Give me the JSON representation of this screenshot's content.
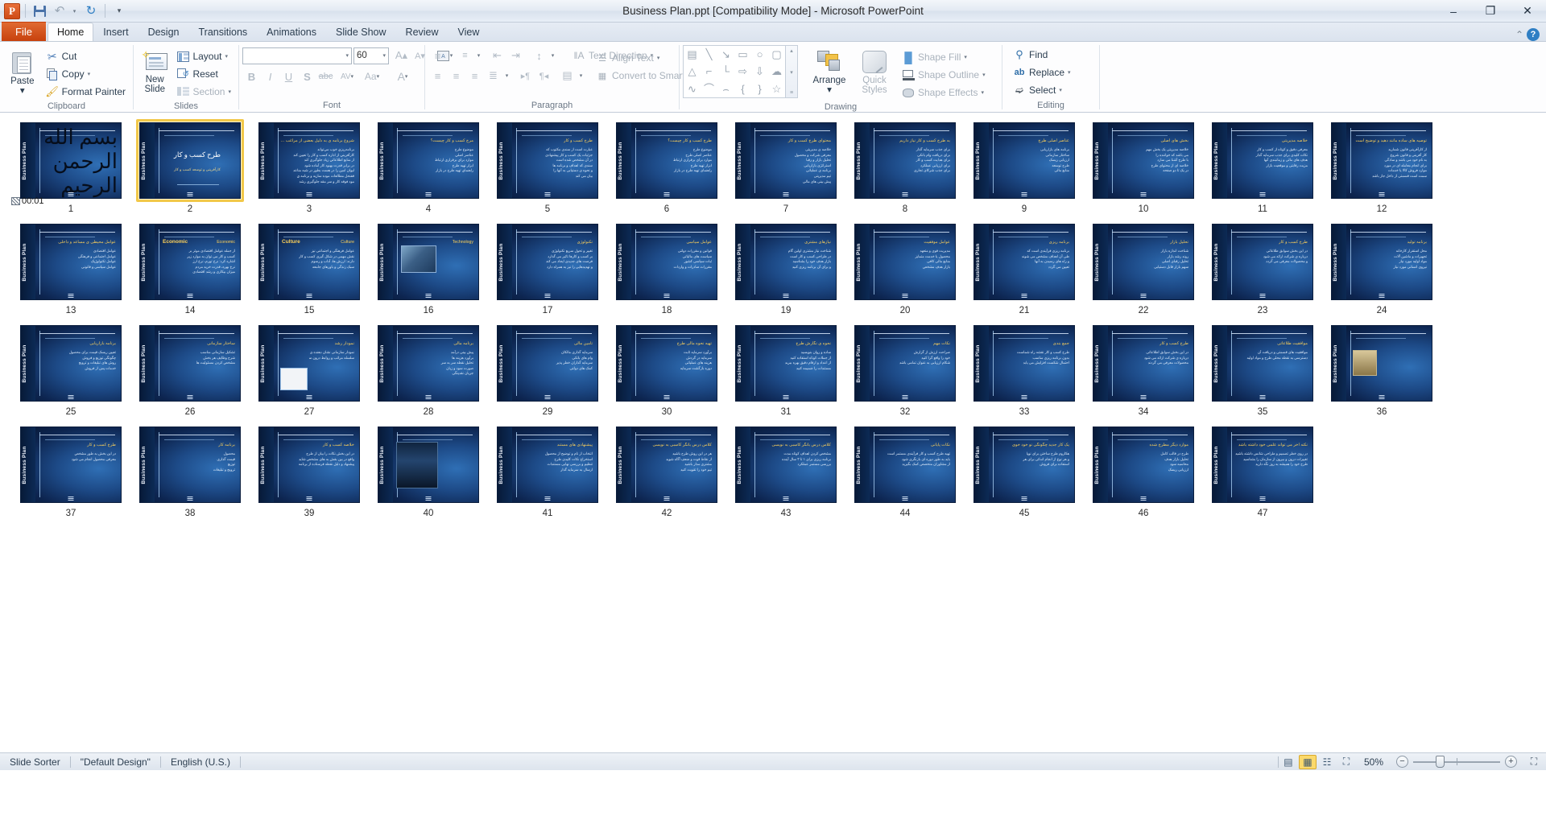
{
  "window": {
    "title": "Business Plan.ppt [Compatibility Mode]  -  Microsoft PowerPoint",
    "logo": "P",
    "minimize": "–",
    "restore": "❐",
    "close": "✕"
  },
  "qat": {
    "save": "save-icon",
    "undo": "↶",
    "undo_caret": "▾",
    "redo": "↻",
    "customize": "▾"
  },
  "tabs": [
    {
      "label": "File",
      "active": false,
      "file": true
    },
    {
      "label": "Home",
      "active": true
    },
    {
      "label": "Insert",
      "active": false
    },
    {
      "label": "Design",
      "active": false
    },
    {
      "label": "Transitions",
      "active": false
    },
    {
      "label": "Animations",
      "active": false
    },
    {
      "label": "Slide Show",
      "active": false
    },
    {
      "label": "Review",
      "active": false
    },
    {
      "label": "View",
      "active": false
    }
  ],
  "tab_right": {
    "minimize_ribbon": "⌃",
    "help": "?"
  },
  "ribbon": {
    "clipboard": {
      "label": "Clipboard",
      "paste": "Paste",
      "paste_dd": "▾",
      "cut": "Cut",
      "copy": "Copy",
      "format_painter": "Format Painter",
      "dialog_launcher": "⤵"
    },
    "slides": {
      "label": "Slides",
      "new_slide": "New",
      "new_slide_2": "Slide",
      "new_slide_dd": "▾",
      "layout": "Layout",
      "reset": "Reset",
      "section": "Section"
    },
    "font": {
      "label": "Font",
      "font_name": "",
      "font_size": "60",
      "grow": "A▴",
      "shrink": "A▾",
      "clear_formatting": "clear-formatting-icon",
      "bold": "B",
      "italic": "I",
      "underline": "U",
      "shadow": "S",
      "strikethrough": "abc",
      "char_spacing": "AV",
      "change_case": "Aa",
      "font_color": "A",
      "dialog_launcher": "⤵"
    },
    "paragraph": {
      "label": "Paragraph",
      "bullets": "bullets-icon",
      "numbering": "numbering-icon",
      "decrease_indent": "decrease-indent-icon",
      "increase_indent": "increase-indent-icon",
      "line_spacing": "line-spacing-icon",
      "align_left": "align-left-icon",
      "align_center": "align-center-icon",
      "align_right": "align-right-icon",
      "justify": "justify-icon",
      "ltr": "ltr-icon",
      "rtl": "rtl-icon",
      "columns": "columns-icon",
      "text_direction": "Text Direction",
      "align_text": "Align Text",
      "convert_smartart": "Convert to SmartArt",
      "dialog_launcher": "⤵"
    },
    "drawing": {
      "label": "Drawing",
      "shapes": [
        "▤",
        "╲",
        "↘",
        "▭",
        "○",
        "▢",
        "△",
        "⌐",
        "└",
        "⇨",
        "⇩",
        "☁",
        "∿",
        "⌒",
        "⌢",
        "{",
        "}",
        "☆"
      ],
      "scroll_up": "▴",
      "scroll_down": "▾",
      "scroll_more": "≡",
      "arrange": "Arrange",
      "arrange_dd": "▾",
      "quick_styles": "Quick",
      "quick_styles_2": "Styles",
      "shape_fill": "Shape Fill",
      "shape_outline": "Shape Outline",
      "shape_effects": "Shape Effects",
      "dialog_launcher": "⤵"
    },
    "editing": {
      "label": "Editing",
      "find": "Find",
      "replace": "Replace",
      "select": "Select"
    }
  },
  "sorter": {
    "timer": "00:01",
    "selected_slide": 2,
    "vertical_label": "Business Plan",
    "slides": [
      {
        "n": 1,
        "kind": "calligraphy",
        "calli": "بسم الله الرحمن الرحیم"
      },
      {
        "n": 2,
        "kind": "title",
        "title": "طرح کسب و کار",
        "sub": "کارآفرینی و توسعه کسب و کار"
      },
      {
        "n": 3,
        "kind": "bullets",
        "title": "شروع برنامه ی به دلیل بعضی از مراغب اين",
        "lines": [
          "برنامه‌ريزي خوب مي‌تواند",
          "کارآفريني از اداره کسب و کار را تعيين کند",
          "از منابع اطلاعاتي زياد جلوگيري کند",
          "در برابر قدرت بهبود کار آماده شود",
          "لیوان امین را در هست بطور در شبه مناعد",
          "قفنحل مطالعات موده سازيه و برنامه ي",
          "مود فوقه کار و سر مقه جلوگيري رشد"
        ]
      },
      {
        "n": 4,
        "kind": "bullets",
        "title": "مرح کسب و کار چيست؟",
        "lines": [
          "موضوع طرح",
          "عناصر اصلي",
          "موارد براي برقراري ارتباط",
          "ابزار تهيه طرح",
          "راهنماي تهيه طرح در بازار"
        ]
      },
      {
        "n": 5,
        "kind": "bullets",
        "title": "طرح کسب و کار",
        "lines": [
          "عبارت است از سندی مکتوب که",
          "جزئیات یک کسب و کار پیشنهادی",
          "در آن مشخص شده است",
          "سندی که اهداف و برنامه ها",
          "و نحوه ی دستیابی به آنها را",
          "بیان می کند"
        ]
      },
      {
        "n": 6,
        "kind": "bullets",
        "title": "طرح کسب و کار چیست؟",
        "lines": [
          "موضوع طرح",
          "عناصر اصلی طرح",
          "موارد برای برقراری ارتباط",
          "ابزار تهیه طرح",
          "راهنمای تهیه طرح در بازار"
        ]
      },
      {
        "n": 7,
        "kind": "bullets",
        "title": "محتوای طرح کسب و کار",
        "lines": [
          "خلاصه ی مدیریتی",
          "معرفی شرکت و محصول",
          "تحلیل بازار و رقبا",
          "استراتژی بازاریابی",
          "برنامه ی عملیاتی",
          "تیم مدیریتی",
          "پیش بینی های مالی"
        ]
      },
      {
        "n": 8,
        "kind": "bullets",
        "title": "به طرح کسب و کار نیاز داریم",
        "lines": [
          "برای جذب سرمایه گذار",
          "برای دریافت وام بانکی",
          "برای هدایت کسب و کار",
          "برای ارزیابی عملکرد",
          "برای جذب شرکای تجاری"
        ]
      },
      {
        "n": 9,
        "kind": "bullets",
        "title": "عناصر اصلی طرح",
        "lines": [
          "برنامه های بازاریابی",
          "ساختار سازمانی",
          "ارزیابی ریسک",
          "طرح توسعه",
          "منابع مالی"
        ]
      },
      {
        "n": 10,
        "kind": "bullets",
        "title": "بخش های اصلی",
        "lines": [
          "خلاصه مدیریتی یک بخش مهم",
          "می باشد که خواننده را",
          "با طرح آشنا می سازد",
          "خلاصه ای از محتوای طرح",
          "در یک تا دو صفحه"
        ]
      },
      {
        "n": 11,
        "kind": "bullets",
        "title": "خلاصه مدیریتی",
        "lines": [
          "معرفی دقیق و کوتاه از کسب و کار",
          "نکات کلیدی برای جذب سرمایه گذار",
          "هدف های مالی و زمانبندی آنها",
          "مزیت رقابتی و موقعیت بازار"
        ]
      },
      {
        "n": 12,
        "kind": "bullets",
        "title": "توصیه های ساده مانند دهید و توضیح است",
        "lines": [
          "از کارآفرینی قانون شمارید",
          "کار آفرینی و قانون شروع",
          "به نام خود می باشد و سادگی",
          "برای انجام معامله ای در مورد",
          "موارد فروش کالا یا خدمات",
          "سمت است قسمتی از داخل جاز باشد"
        ]
      },
      {
        "n": 13,
        "kind": "bullets",
        "title": "عوامل محیطی ی مساعد و داخلی",
        "lines": [
          "عوامل اقتصادی",
          "عوامل اجتماعی و فرهنگی",
          "عوامل تکنولوژیک",
          "عوامل سیاسی و قانونی"
        ]
      },
      {
        "n": 14,
        "kind": "keyword",
        "title": "Economic",
        "lines": [
          "از جمله عوامل اقتصادی موثر بر",
          "کسب و کار می توان به موارد زیر",
          "اشاره کرد: نرخ تورم، نرخ ارز",
          "نرخ بهره، قدرت خرید مردم",
          "میزان بیکاری و رشد اقتصادی"
        ]
      },
      {
        "n": 15,
        "kind": "keyword",
        "title": "Culture",
        "lines": [
          "عوامل فرهنگی و اجتماعی نیز",
          "نقش مهمی در شکل گیری کسب و کار",
          "دارند: ارزش ها، آداب و رسوم",
          "سبک زندگی و باورهای جامعه"
        ]
      },
      {
        "n": 16,
        "kind": "photo",
        "title": "Technology",
        "photo": "tech-photo"
      },
      {
        "n": 17,
        "kind": "bullets",
        "title": "تکنولوژی",
        "lines": [
          "تغییر و تحول سریع تکنولوژی",
          "بر کسب و کارها تاثیر می گذارد",
          "فرصت های جدیدی ایجاد می کند",
          "و تهدیدهایی را نیز به همراه دارد"
        ]
      },
      {
        "n": 18,
        "kind": "bullets",
        "title": "عوامل سیاسی",
        "lines": [
          "قوانین و مقررات دولتی",
          "سیاست های مالیاتی",
          "ثبات سیاسی کشور",
          "مقررات صادرات و واردات"
        ]
      },
      {
        "n": 19,
        "kind": "bullets",
        "title": "نیازهای مشتری",
        "lines": [
          "شناخت نیاز مشتری اولین گام",
          "در طراحی کسب و کار است",
          "بازار هدف خود را بشناسید",
          "و برای آن برنامه ریزی کنید"
        ]
      },
      {
        "n": 20,
        "kind": "bullets",
        "title": "عوامل موفقیت",
        "lines": [
          "مدیریت قوی و متعهد",
          "محصول یا خدمت متمایز",
          "منابع مالی کافی",
          "بازار هدف مشخص"
        ]
      },
      {
        "n": 21,
        "kind": "bullets",
        "title": "برنامه ریزی",
        "lines": [
          "برنامه ریزی فرآیندی است که",
          "طی آن اهداف مشخص می شوند",
          "و راه های رسیدن به آنها",
          "تعیین می گردد"
        ]
      },
      {
        "n": 22,
        "kind": "bullets",
        "title": "تحلیل بازار",
        "lines": [
          "شناخت اندازه بازار",
          "روند رشد بازار",
          "تحلیل رقبای اصلی",
          "سهم بازار قابل دستیابی"
        ]
      },
      {
        "n": 23,
        "kind": "bullets",
        "title": "طرح کسب و کار",
        "lines": [
          "در این بخش سوابق طلاعاتی",
          "درباره ی شرکت ارائه می شود",
          "و محصولات معرفی می گردد"
        ]
      },
      {
        "n": 24,
        "kind": "bullets",
        "title": "برنامه تولید",
        "lines": [
          "محل استقرار کارخانه",
          "تجهیزات و ماشین آلات",
          "مواد اولیه مورد نیاز",
          "نیروی انسانی مورد نیاز"
        ]
      },
      {
        "n": 25,
        "kind": "bullets",
        "title": "برنامه بازاریابی",
        "lines": [
          "تعیین ریسک قیمت برای محصول",
          "چگونگی توزیع و فروش",
          "روش های تبلیغات و ترویج",
          "خدمات پس از فروش"
        ]
      },
      {
        "n": 26,
        "kind": "bullets",
        "title": "ساختار سازمانی",
        "lines": [
          "تشکیل سازمانی مناسب",
          "شرح وظایف هر بخش",
          "مشخص کردن مسئولیت ها"
        ]
      },
      {
        "n": 27,
        "kind": "chart",
        "title": "نمودار رشد",
        "lines": [
          "نمودار سازمانی نشان دهنده ی",
          "سلسله مراتب و روابط درون سازمان"
        ]
      },
      {
        "n": 28,
        "kind": "bullets",
        "title": "برنامه مالی",
        "lines": [
          "پیش بینی درآمد",
          "برآورد هزینه ها",
          "تحلیل نقطه سر به سر",
          "صورت سود و زیان",
          "جریان نقدینگی"
        ]
      },
      {
        "n": 29,
        "kind": "bullets",
        "title": "تامین مالی",
        "lines": [
          "سرمایه گذاری مالکان",
          "وام های بانکی",
          "سرمایه گذاران خطر پذیر",
          "کمک های دولتی"
        ]
      },
      {
        "n": 30,
        "kind": "bullets",
        "title": "تهیه نحوه مالی طرح",
        "lines": [
          "برآورد سرمایه ثابت",
          "سرمایه در گردش",
          "هزینه های عملیاتی",
          "دوره بازگشت سرمایه"
        ]
      },
      {
        "n": 31,
        "kind": "bullets",
        "title": "نحوه ی نگارش طرح",
        "lines": [
          "ساده و روان بنویسید",
          "از جملات کوتاه استفاده کنید",
          "از اعداد و ارقام دقیق بهره ببرید",
          "مستندات را ضمیمه کنید"
        ]
      },
      {
        "n": 32,
        "kind": "bullets",
        "title": "نکات مهم",
        "lines": [
          "صراحت ارزش از گزارش",
          "خود را واقع گرا کنید",
          "شکام ارزیابی به عنوان تمامی باشد"
        ]
      },
      {
        "n": 33,
        "kind": "bullets",
        "title": "جمع بندی",
        "lines": [
          "طرح کسب و کار نقشه راه شماست",
          "بدون برنامه ریزی مناسب",
          "احتمال شکست افزایش می یابد"
        ]
      },
      {
        "n": 34,
        "kind": "bullets",
        "title": "طرح کسب و کار",
        "lines": [
          "در این بخش سوابق اطلاعاتی",
          "درباره ی شرکت ارائه می شود",
          "محصولات معرفی می گردند"
        ]
      },
      {
        "n": 35,
        "kind": "bullets",
        "title": "موافقیت طلاعاتی",
        "lines": [
          "موافقیت های قسمتی و دریافت آن",
          "دسترسی به نقطه محلی طرح و مواد اولیه"
        ]
      },
      {
        "n": 36,
        "kind": "photo",
        "title": "",
        "photo": "person-photo"
      },
      {
        "n": 37,
        "kind": "bullets",
        "title": "طرح کسب و کار",
        "lines": [
          "در این بخش به طور مشخص",
          "معرفی محصول انجام می شود"
        ]
      },
      {
        "n": 38,
        "kind": "bullets",
        "title": "برنامه کار",
        "lines": [
          "محصول",
          "قیمت گذاری",
          "توزیع",
          "ترویج و تبلیغات"
        ]
      },
      {
        "n": 39,
        "kind": "bullets",
        "title": "خلاصه کسب و کار",
        "lines": [
          "در این بخش نکات را بیان از طرح",
          "واقع در بین بقش به های مشخص شاید",
          "پیشنهاد و دلیل نقطه فرستاده از برنامه"
        ]
      },
      {
        "n": 40,
        "kind": "photo",
        "title": "",
        "photo": "speaker-photo"
      },
      {
        "n": 41,
        "kind": "bullets",
        "title": "پیشنهادی های مستند",
        "lines": [
          "انتخاب از نام و توضیح از محصول",
          "استخراج نکات کلیدی طرح",
          "تنظیم و بررسی نهایی مستندات",
          "ارسال به سرمایه گذار"
        ]
      },
      {
        "n": 42,
        "kind": "bullets",
        "title": "کلاس درس بانگر کاسبی به نویسی",
        "lines": [
          "هر در این روش طرح باشید",
          "از نقاط قوت و ضعف آگاه شوید",
          "مشتری مدار باشید",
          "تیم خود را تقویت کنید"
        ]
      },
      {
        "n": 43,
        "kind": "bullets",
        "title": "کلاس درس بانگر کاسبی به نویسی",
        "lines": [
          "مشخص کردن اهداف کوتاه مدت",
          "برنامه ریزی برای ۱ تا ۳ سال آینده",
          "بررسی مستمر عملکرد"
        ]
      },
      {
        "n": 44,
        "kind": "bullets",
        "title": "نکات پایانی",
        "lines": [
          "تهیه طرح کسب و کار فرآیندی مستمر است",
          "باید به طور دوره ای بازنگری شود",
          "از مشاوران متخصص کمک بگیرید"
        ]
      },
      {
        "n": 45,
        "kind": "bullets",
        "title": "یک کار جدید چگونگی نو خود خوی",
        "lines": [
          "هکاروم طرح ساختن برای نوپا",
          "و هر نوع از انجام اندکی برای هر",
          "استفاده برای فروش"
        ]
      },
      {
        "n": 46,
        "kind": "bullets",
        "title": "موارد دیگر مطرح شده",
        "lines": [
          "طرح در قالب کامل",
          "تحلیل بازار هدف",
          "محاسبه سود",
          "ارزیابی ریسک"
        ]
      },
      {
        "n": 47,
        "kind": "bullets",
        "title": "نکته آخر می تواند علمی خود داشته باشد",
        "lines": [
          "در روی خطر تصمیم و طراحی شانس داشته باشید",
          "تغییرات درون و بیرون از سازمان را بشناسید",
          "طرح خود را همیشه به روز نگه دارید"
        ]
      }
    ]
  },
  "statusbar": {
    "view_mode": "Slide Sorter",
    "theme": "\"Default Design\"",
    "language": "English (U.S.)",
    "views": [
      {
        "name": "normal-view",
        "glyph": "▤",
        "active": false
      },
      {
        "name": "slide-sorter-view",
        "glyph": "▦",
        "active": true
      },
      {
        "name": "reading-view",
        "glyph": "☷",
        "active": false
      },
      {
        "name": "slide-show-view",
        "glyph": "⛶",
        "active": false
      }
    ],
    "zoom_percent": "50%",
    "zoom_out": "−",
    "zoom_in": "+",
    "fit_to_window": "⛶"
  }
}
